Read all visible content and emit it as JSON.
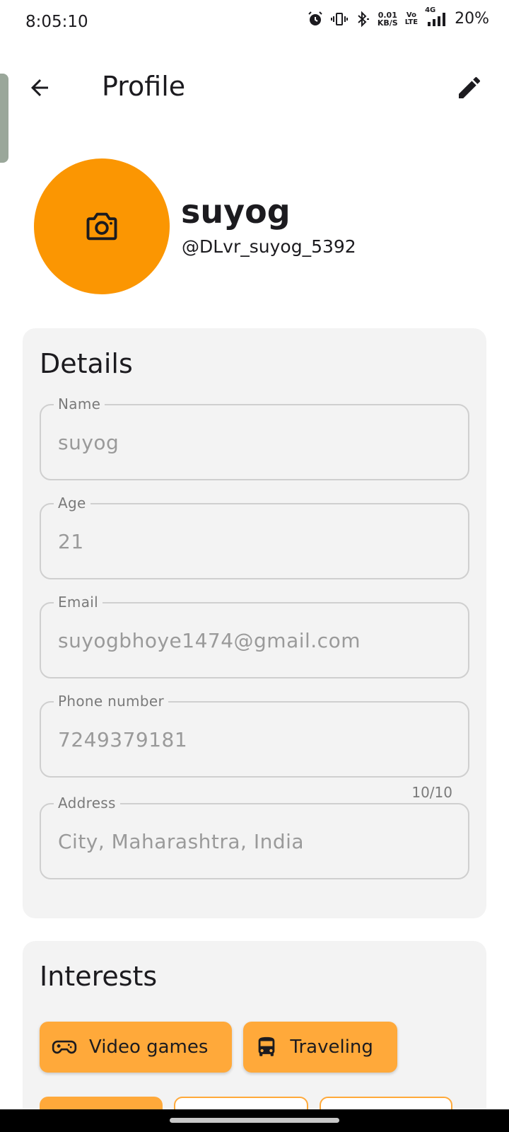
{
  "status_bar": {
    "time": "8:05:10",
    "net_speed_value": "0.01",
    "net_speed_unit": "KB/S",
    "volte_top": "Vo",
    "volte_bottom": "LTE",
    "network_type": "4G",
    "battery": "20%"
  },
  "app_bar": {
    "title": "Profile"
  },
  "profile": {
    "name": "suyog",
    "handle": "@DLvr_suyog_5392"
  },
  "details": {
    "title": "Details",
    "fields": [
      {
        "label": "Name",
        "value": "suyog"
      },
      {
        "label": "Age",
        "value": "21"
      },
      {
        "label": "Email",
        "value": "suyogbhoye1474@gmail.com"
      },
      {
        "label": "Phone number",
        "value": "7249379181"
      },
      {
        "label": "Address",
        "value": "City, Maharashtra, India"
      }
    ],
    "phone_counter": "10/10"
  },
  "interests": {
    "title": "Interests",
    "chips": [
      {
        "label": "Video games",
        "icon": "gamepad-icon",
        "selected": true
      },
      {
        "label": "Traveling",
        "icon": "bus-icon",
        "selected": true
      }
    ]
  },
  "colors": {
    "accent": "#fb9602",
    "chip_selected": "#ffa93a",
    "card_background": "#f3f3f3"
  }
}
